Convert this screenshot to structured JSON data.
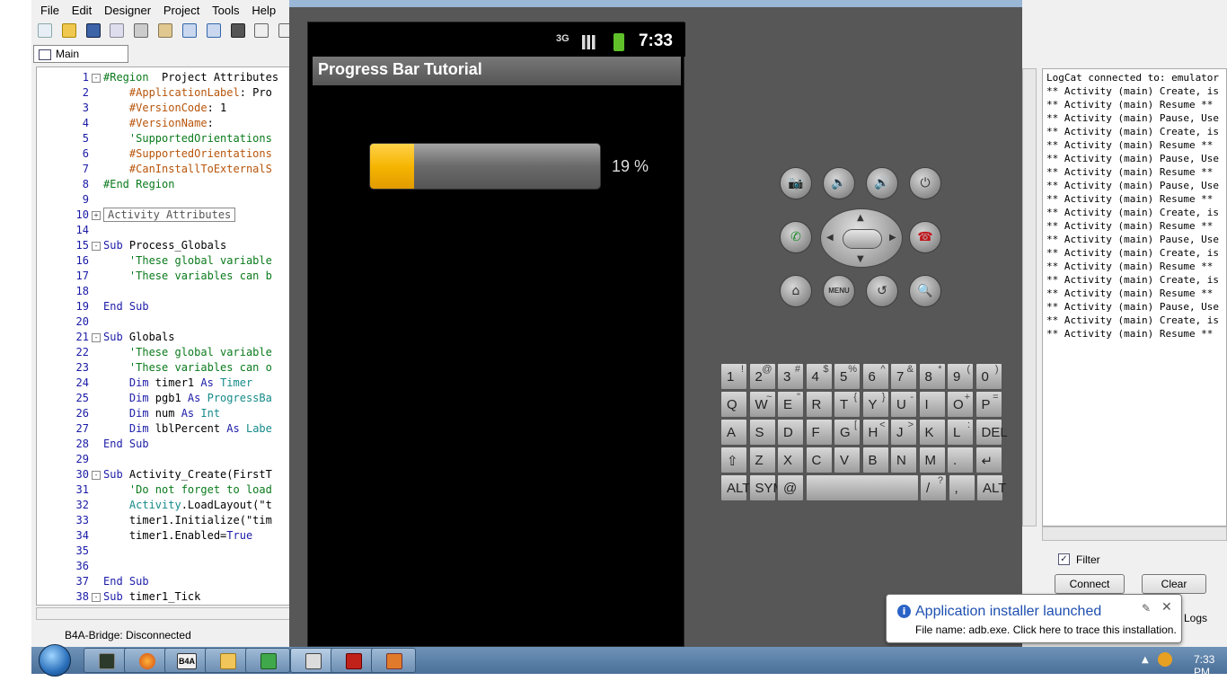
{
  "ide": {
    "menu": [
      "File",
      "Edit",
      "Designer",
      "Project",
      "Tools",
      "Help"
    ],
    "tab_label": "Main",
    "status": "B4A-Bridge: Disconnected",
    "lines": [
      {
        "n": "1",
        "fold": "-",
        "parts": [
          {
            "c": "cm",
            "t": "#Region  "
          },
          {
            "c": "",
            "t": "Project Attributes"
          }
        ]
      },
      {
        "n": "2",
        "fold": "",
        "parts": [
          {
            "c": "dir",
            "t": "    #ApplicationLabel"
          },
          {
            "c": "",
            "t": ": Pro"
          }
        ]
      },
      {
        "n": "3",
        "fold": "",
        "parts": [
          {
            "c": "dir",
            "t": "    #VersionCode"
          },
          {
            "c": "",
            "t": ": 1"
          }
        ]
      },
      {
        "n": "4",
        "fold": "",
        "parts": [
          {
            "c": "dir",
            "t": "    #VersionName"
          },
          {
            "c": "",
            "t": ":"
          }
        ]
      },
      {
        "n": "5",
        "fold": "",
        "parts": [
          {
            "c": "cm",
            "t": "    'SupportedOrientations"
          }
        ]
      },
      {
        "n": "6",
        "fold": "",
        "parts": [
          {
            "c": "dir",
            "t": "    #SupportedOrientations"
          }
        ]
      },
      {
        "n": "7",
        "fold": "",
        "parts": [
          {
            "c": "dir",
            "t": "    #CanInstallToExternalS"
          }
        ]
      },
      {
        "n": "8",
        "fold": "",
        "parts": [
          {
            "c": "cm",
            "t": "#End Region"
          }
        ]
      },
      {
        "n": "9",
        "fold": "",
        "parts": []
      },
      {
        "n": "10",
        "fold": "+",
        "parts": [
          {
            "c": "region",
            "t": "Activity Attributes"
          }
        ]
      },
      {
        "n": "14",
        "fold": "",
        "parts": []
      },
      {
        "n": "15",
        "fold": "-",
        "parts": [
          {
            "c": "kw",
            "t": "Sub "
          },
          {
            "c": "",
            "t": "Process_Globals"
          }
        ]
      },
      {
        "n": "16",
        "fold": "",
        "parts": [
          {
            "c": "cm",
            "t": "    'These global variable"
          }
        ]
      },
      {
        "n": "17",
        "fold": "",
        "parts": [
          {
            "c": "cm",
            "t": "    'These variables can b"
          }
        ]
      },
      {
        "n": "18",
        "fold": "",
        "parts": []
      },
      {
        "n": "19",
        "fold": "",
        "parts": [
          {
            "c": "kw",
            "t": "End Sub"
          }
        ]
      },
      {
        "n": "20",
        "fold": "",
        "parts": []
      },
      {
        "n": "21",
        "fold": "-",
        "parts": [
          {
            "c": "kw",
            "t": "Sub "
          },
          {
            "c": "",
            "t": "Globals"
          }
        ]
      },
      {
        "n": "22",
        "fold": "",
        "parts": [
          {
            "c": "cm",
            "t": "    'These global variable"
          }
        ]
      },
      {
        "n": "23",
        "fold": "",
        "parts": [
          {
            "c": "cm",
            "t": "    'These variables can o"
          }
        ]
      },
      {
        "n": "24",
        "fold": "",
        "parts": [
          {
            "c": "kw",
            "t": "    Dim "
          },
          {
            "c": "",
            "t": "timer1 "
          },
          {
            "c": "kw",
            "t": "As "
          },
          {
            "c": "ty",
            "t": "Timer"
          }
        ]
      },
      {
        "n": "25",
        "fold": "",
        "parts": [
          {
            "c": "kw",
            "t": "    Dim "
          },
          {
            "c": "",
            "t": "pgb1 "
          },
          {
            "c": "kw",
            "t": "As "
          },
          {
            "c": "ty",
            "t": "ProgressBa"
          }
        ]
      },
      {
        "n": "26",
        "fold": "",
        "parts": [
          {
            "c": "kw",
            "t": "    Dim "
          },
          {
            "c": "",
            "t": "num "
          },
          {
            "c": "kw",
            "t": "As "
          },
          {
            "c": "ty",
            "t": "Int"
          }
        ]
      },
      {
        "n": "27",
        "fold": "",
        "parts": [
          {
            "c": "kw",
            "t": "    Dim "
          },
          {
            "c": "",
            "t": "lblPercent "
          },
          {
            "c": "kw",
            "t": "As "
          },
          {
            "c": "ty",
            "t": "Labe"
          }
        ]
      },
      {
        "n": "28",
        "fold": "",
        "parts": [
          {
            "c": "kw",
            "t": "End Sub"
          }
        ]
      },
      {
        "n": "29",
        "fold": "",
        "parts": []
      },
      {
        "n": "30",
        "fold": "-",
        "parts": [
          {
            "c": "kw",
            "t": "Sub "
          },
          {
            "c": "",
            "t": "Activity_Create(FirstT"
          }
        ]
      },
      {
        "n": "31",
        "fold": "",
        "parts": [
          {
            "c": "cm",
            "t": "    'Do not forget to load"
          }
        ]
      },
      {
        "n": "32",
        "fold": "",
        "parts": [
          {
            "c": "ty",
            "t": "    Activity"
          },
          {
            "c": "",
            "t": ".LoadLayout(\"t"
          }
        ]
      },
      {
        "n": "33",
        "fold": "",
        "parts": [
          {
            "c": "",
            "t": "    timer1.Initialize(\"tim"
          }
        ]
      },
      {
        "n": "34",
        "fold": "",
        "parts": [
          {
            "c": "",
            "t": "    timer1.Enabled="
          },
          {
            "c": "kw",
            "t": "True"
          }
        ]
      },
      {
        "n": "35",
        "fold": "",
        "parts": []
      },
      {
        "n": "36",
        "fold": "",
        "parts": []
      },
      {
        "n": "37",
        "fold": "",
        "parts": [
          {
            "c": "kw",
            "t": "End Sub"
          }
        ]
      },
      {
        "n": "38",
        "fold": "-",
        "parts": [
          {
            "c": "kw",
            "t": "Sub "
          },
          {
            "c": "",
            "t": "timer1_Tick"
          }
        ]
      }
    ]
  },
  "emulator": {
    "clock": "7:33",
    "app_title": "Progress Bar Tutorial",
    "progress_percent": 19,
    "progress_label": "19 %",
    "menu_key": "MENU",
    "keyboard": {
      "row1": [
        "1",
        "2",
        "3",
        "4",
        "5",
        "6",
        "7",
        "8",
        "9",
        "0"
      ],
      "row1_alt": [
        "!",
        "@",
        "#",
        "$",
        "%",
        "^",
        "&",
        "*",
        "(",
        ")"
      ],
      "row2": [
        "Q",
        "W",
        "E",
        "R",
        "T",
        "Y",
        "U",
        "I",
        "O",
        "P"
      ],
      "row2_alt": [
        "",
        "~",
        "\"",
        "",
        "{",
        "}",
        "-",
        "",
        "+",
        "="
      ],
      "row3": [
        "A",
        "S",
        "D",
        "F",
        "G",
        "H",
        "J",
        "K",
        "L",
        "DEL"
      ],
      "row3_alt": [
        "",
        "",
        "",
        "",
        "[",
        "<",
        ">",
        "",
        ":",
        ""
      ],
      "row4": [
        "⇧",
        "Z",
        "X",
        "C",
        "V",
        "B",
        "N",
        "M",
        ".",
        "↵"
      ],
      "row5": [
        "ALT",
        "SYM",
        "@",
        "",
        "/",
        "?",
        ",",
        "ALT"
      ]
    }
  },
  "logcat": {
    "header": "LogCat connected to: emulator",
    "lines": [
      "** Activity (main) Create, is",
      "** Activity (main) Resume **",
      "** Activity (main) Pause, Use",
      "** Activity (main) Create, is",
      "** Activity (main) Resume **",
      "** Activity (main) Pause, Use",
      "** Activity (main) Resume **",
      "** Activity (main) Pause, Use",
      "** Activity (main) Resume **",
      "** Activity (main) Create, is",
      "** Activity (main) Resume **",
      "** Activity (main) Pause, Use",
      "** Activity (main) Create, is",
      "** Activity (main) Resume **",
      "** Activity (main) Create, is",
      "** Activity (main) Resume **",
      "** Activity (main) Pause, Use",
      "** Activity (main) Create, is",
      "** Activity (main) Resume **"
    ],
    "filter_label": "Filter",
    "filter_checked": true,
    "connect_label": "Connect",
    "clear_label": "Clear",
    "logs_tab": "Logs"
  },
  "toast": {
    "title": "Application installer launched",
    "body": "File name: adb.exe. Click here to trace this installation."
  },
  "taskbar": {
    "b4a_label": "B4A",
    "time": "7:33 PM"
  }
}
